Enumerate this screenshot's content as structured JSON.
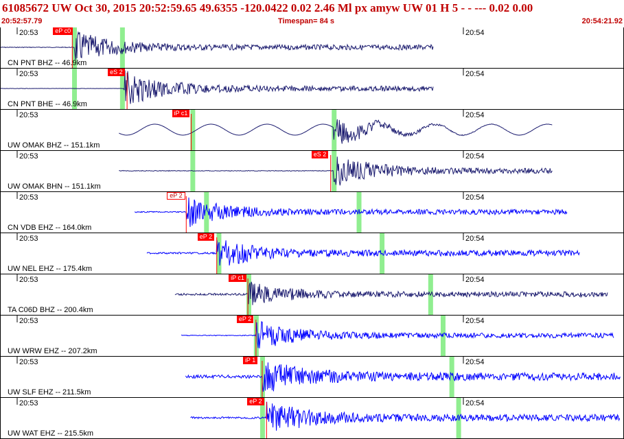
{
  "header": {
    "title": "61085672 UW Oct 30, 2015 20:52:59.65    49.6355 -120.0422  0.02 2.46 Ml px     amyw      UW 01 H     5   -   - ---   0.02 0.00",
    "start_time": "20:52:57.79",
    "timespan": "Timespan=  84 s",
    "end_time": "20:54:21.92"
  },
  "colors": {
    "trace_dark": "#1a1a6e",
    "trace_blue": "#0000ff",
    "pick_red": "#ff0000",
    "window_green": "#90ee90"
  },
  "traces": [
    {
      "station": "CN PNT BHZ -- 46.9km",
      "minute1": "20:53",
      "minute2": "20:54",
      "pick": "eP c0",
      "pick_style": "filled",
      "color": "dark",
      "start": 0.0,
      "end": 0.695,
      "pick_pos": 0.115,
      "green": [
        0.118,
        0.195
      ],
      "amp": 22,
      "noise": 0.12,
      "kind": "quake",
      "event": 0.118
    },
    {
      "station": "CN PNT BHE -- 46.9km",
      "minute1": "20:53",
      "minute2": "20:54",
      "pick": "eS 2",
      "pick_style": "filled",
      "color": "dark",
      "start": 0.0,
      "end": 0.695,
      "pick_pos": 0.203,
      "green": [
        0.118,
        0.195
      ],
      "amp": 24,
      "noise": 0.05,
      "kind": "quake",
      "event": 0.198
    },
    {
      "station": "UW OMAK BHZ -- 151.1km",
      "minute1": "20:53",
      "minute2": "20:54",
      "pick": "iP c1",
      "pick_style": "filled",
      "color": "dark",
      "start": 0.19,
      "end": 0.886,
      "pick_pos": 0.306,
      "green": [
        0.308,
        0.535
      ],
      "amp": 20,
      "noise": 0.05,
      "kind": "wave",
      "event": 0.535
    },
    {
      "station": "UW OMAK BHN -- 151.1km",
      "minute1": "20:53",
      "minute2": "20:54",
      "pick": "eS 2",
      "pick_style": "filled",
      "color": "dark",
      "start": 0.19,
      "end": 0.886,
      "pick_pos": 0.53,
      "green": [
        0.308,
        0.535
      ],
      "amp": 22,
      "noise": 0.12,
      "kind": "quake",
      "event": 0.535
    },
    {
      "station": "CN VDB EHZ -- 164.0km",
      "minute1": "20:53",
      "minute2": "20:54",
      "pick": "eP 2",
      "pick_style": "hollow",
      "color": "blue",
      "start": 0.215,
      "end": 0.91,
      "pick_pos": 0.298,
      "green": [
        0.33,
        0.575
      ],
      "amp": 20,
      "noise": 0.2,
      "kind": "quake",
      "event": 0.298
    },
    {
      "station": "UW NEL EHZ -- 175.4km",
      "minute1": "20:53",
      "minute2": "20:54",
      "pick": "eP 2",
      "pick_style": "filled",
      "color": "blue",
      "start": 0.235,
      "end": 0.93,
      "pick_pos": 0.347,
      "green": [
        0.35,
        0.612
      ],
      "amp": 20,
      "noise": 0.3,
      "kind": "quake",
      "event": 0.347
    },
    {
      "station": "TA C06D BHZ -- 200.4km",
      "minute1": "20:53",
      "minute2": "20:54",
      "pick": "iP c1",
      "pick_style": "filled",
      "color": "dark",
      "start": 0.28,
      "end": 0.975,
      "pick_pos": 0.397,
      "green": [
        0.398,
        0.69
      ],
      "amp": 16,
      "noise": 0.35,
      "kind": "quake",
      "event": 0.397
    },
    {
      "station": "UW WRW EHZ -- 207.2km",
      "minute1": "20:53",
      "minute2": "20:54",
      "pick": "eP 2",
      "pick_style": "filled",
      "color": "blue",
      "start": 0.29,
      "end": 0.985,
      "pick_pos": 0.41,
      "green": [
        0.41,
        0.71
      ],
      "amp": 20,
      "noise": 0.15,
      "kind": "quake",
      "event": 0.41
    },
    {
      "station": "UW SLF EHZ -- 211.5km",
      "minute1": "20:53",
      "minute2": "20:54",
      "pick": "iP 1",
      "pick_style": "filled",
      "color": "blue",
      "start": 0.297,
      "end": 0.995,
      "pick_pos": 0.42,
      "green": [
        0.42,
        0.724
      ],
      "amp": 22,
      "noise": 0.6,
      "kind": "quake",
      "event": 0.42
    },
    {
      "station": "UW WAT EHZ -- 215.5km",
      "minute1": "20:53",
      "minute2": "20:54",
      "pick": "eP 2",
      "pick_style": "filled",
      "color": "blue",
      "start": 0.305,
      "end": 0.995,
      "pick_pos": 0.427,
      "green": [
        0.42,
        0.735
      ],
      "amp": 24,
      "noise": 0.35,
      "kind": "quake",
      "event": 0.427
    }
  ]
}
